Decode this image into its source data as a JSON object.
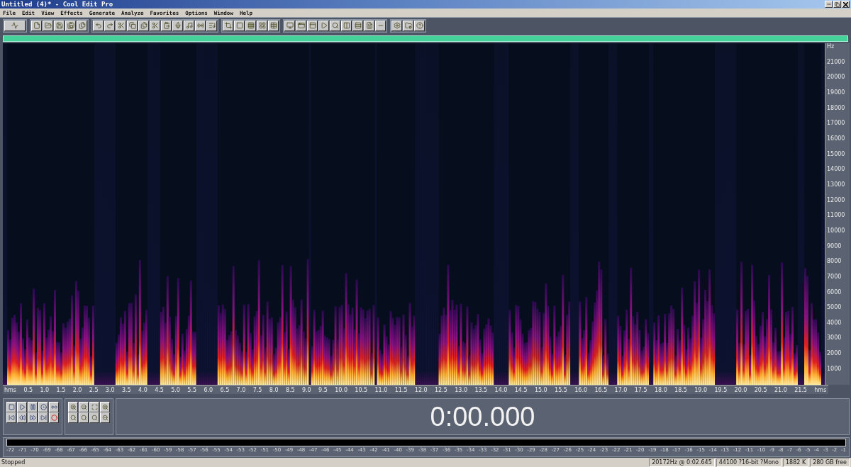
{
  "window": {
    "title": "Untitled (4)* - Cool Edit Pro"
  },
  "menu": [
    "File",
    "Edit",
    "View",
    "Effects",
    "Generate",
    "Analyze",
    "Favorites",
    "Options",
    "Window",
    "Help"
  ],
  "frequency_axis": {
    "unit": "Hz",
    "labels": [
      "21000",
      "20000",
      "19000",
      "18000",
      "17000",
      "16000",
      "15000",
      "14000",
      "13000",
      "12000",
      "11000",
      "10000",
      "9000",
      "8000",
      "7000",
      "6000",
      "5000",
      "4000",
      "3000",
      "2000",
      "1000"
    ]
  },
  "time_axis": {
    "unit_start": "hms",
    "unit_end": "hms",
    "labels": [
      "0.5",
      "1.0",
      "1.5",
      "2.0",
      "2.5",
      "3.0",
      "3.5",
      "4.0",
      "4.5",
      "5.0",
      "5.5",
      "6.0",
      "6.5",
      "7.0",
      "7.5",
      "8.0",
      "8.5",
      "9.0",
      "9.5",
      "10.0",
      "10.5",
      "11.0",
      "11.5",
      "12.0",
      "12.5",
      "13.0",
      "13.5",
      "14.0",
      "14.5",
      "15.0",
      "15.5",
      "16.0",
      "16.5",
      "17.0",
      "17.5",
      "18.0",
      "18.5",
      "19.0",
      "19.5",
      "20.0",
      "20.5",
      "21.0",
      "21.5"
    ]
  },
  "time_display": "0:00.000",
  "level_meter": {
    "labels": [
      "-72",
      "-71",
      "-70",
      "-69",
      "-68",
      "-67",
      "-66",
      "-65",
      "-64",
      "-63",
      "-62",
      "-61",
      "-60",
      "-59",
      "-58",
      "-57",
      "-56",
      "-55",
      "-54",
      "-53",
      "-52",
      "-51",
      "-50",
      "-49",
      "-48",
      "-47",
      "-46",
      "-45",
      "-44",
      "-43",
      "-42",
      "-41",
      "-40",
      "-39",
      "-38",
      "-37",
      "-36",
      "-35",
      "-34",
      "-33",
      "-32",
      "-31",
      "-30",
      "-29",
      "-28",
      "-27",
      "-26",
      "-25",
      "-24",
      "-23",
      "-22",
      "-21",
      "-20",
      "-19",
      "-18",
      "-17",
      "-16",
      "-15",
      "-14",
      "-13",
      "-12",
      "-11",
      "-10",
      "-9",
      "-8",
      "-7",
      "-6",
      "-5",
      "-4",
      "-3",
      "-2",
      "-1"
    ]
  },
  "status_bar": {
    "state": "Stopped",
    "fields": [
      "20172Hz @ 0:02.645",
      "44100 ?16-bit ?Mono",
      "1882 K",
      "280 GB free"
    ]
  }
}
